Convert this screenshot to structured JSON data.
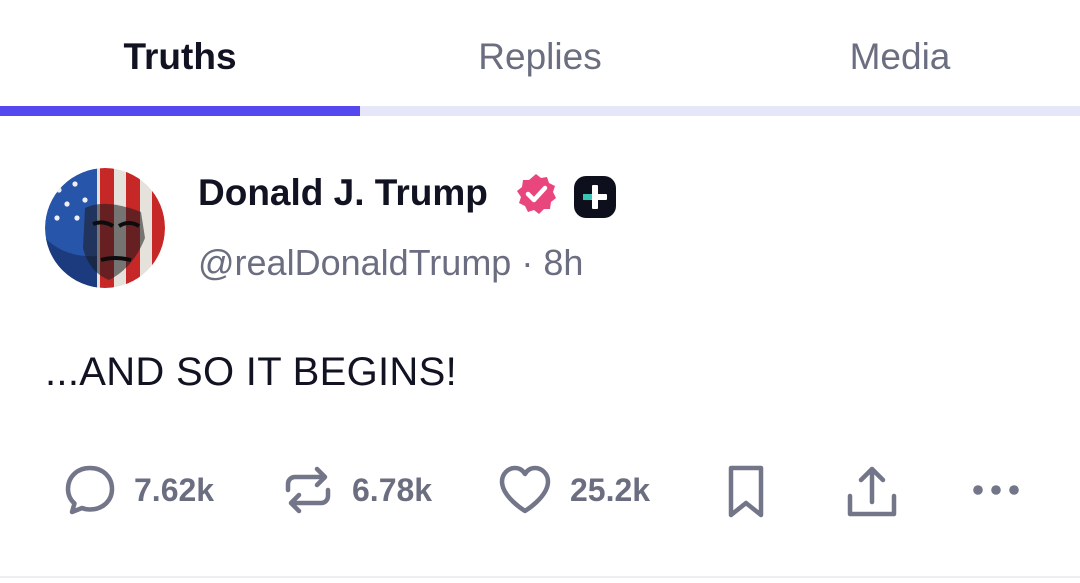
{
  "tabs": [
    {
      "label": "Truths",
      "active": true
    },
    {
      "label": "Replies",
      "active": false
    },
    {
      "label": "Media",
      "active": false
    }
  ],
  "post": {
    "display_name": "Donald J. Trump",
    "handle": "@realDonaldTrump",
    "separator": "·",
    "time": "8h",
    "text": "...AND SO IT BEGINS!",
    "badges": [
      "verified-badge-icon",
      "truth-plus-icon"
    ],
    "actions": {
      "reply_count": "7.62k",
      "retruth_count": "6.78k",
      "like_count": "25.2k"
    }
  },
  "colors": {
    "accent": "#5448ee",
    "tab_track": "#e5e6f7",
    "text_primary": "#111322",
    "text_secondary": "#6b6e80",
    "verified": "#e8467c",
    "icon_gray": "#737588"
  }
}
